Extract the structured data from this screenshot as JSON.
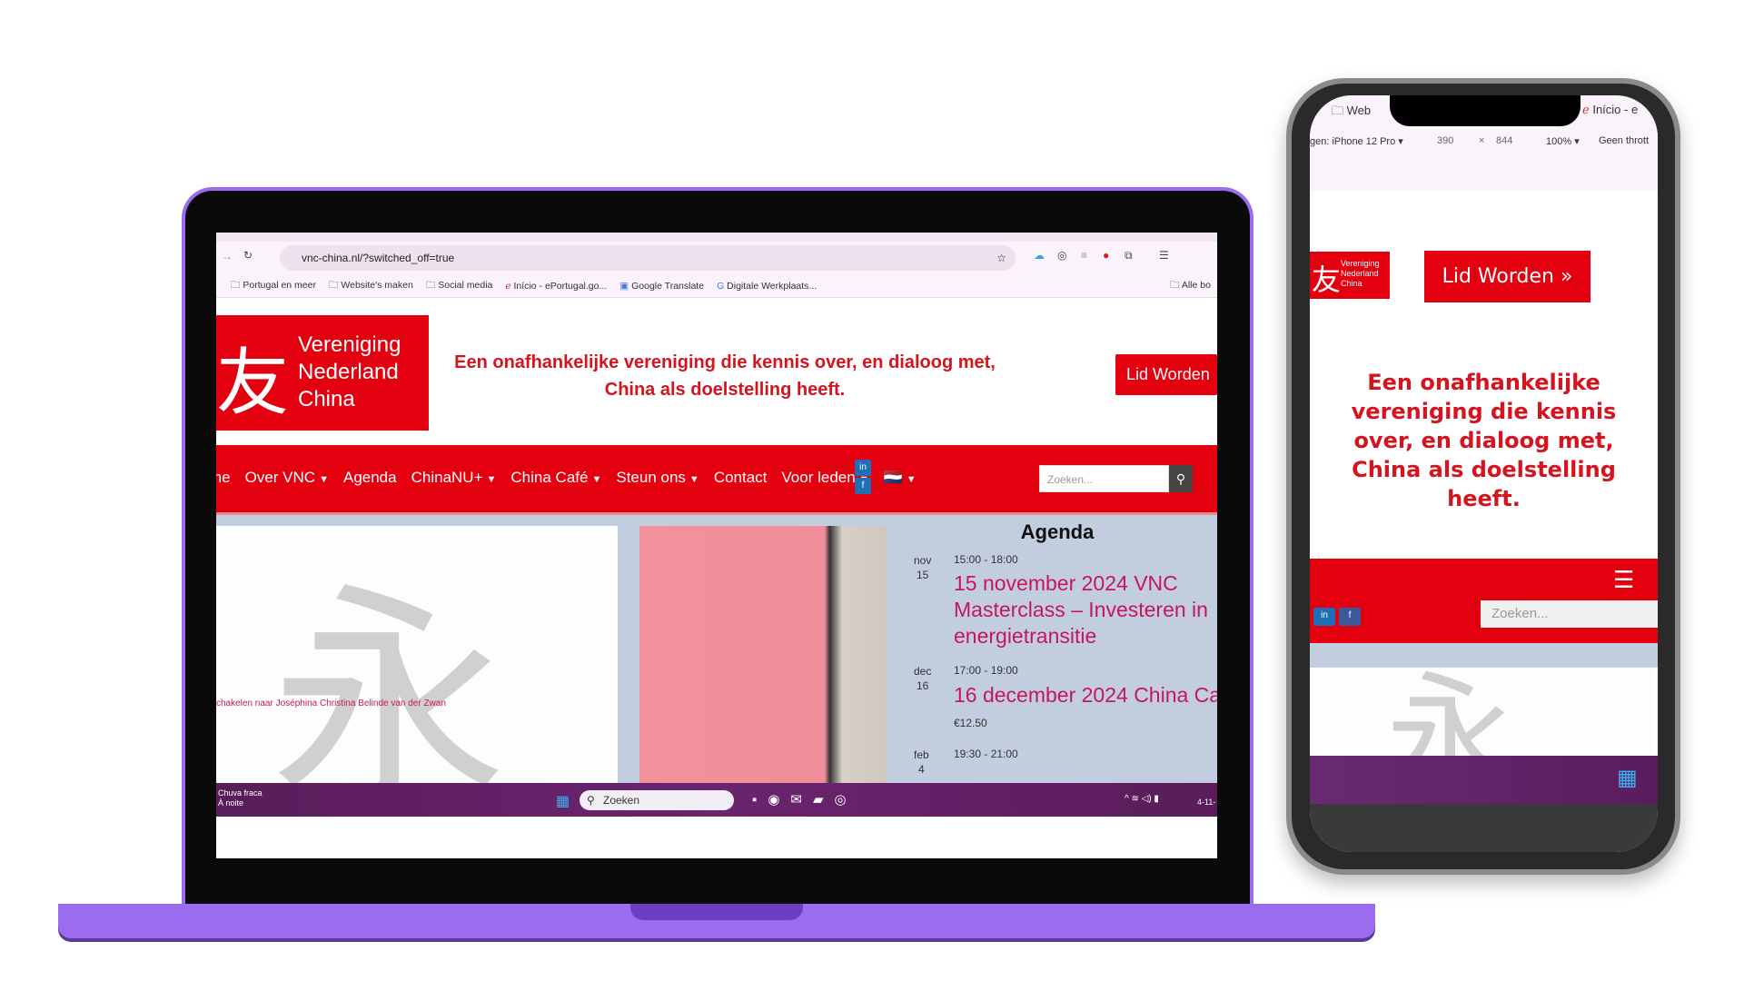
{
  "laptop": {
    "browser": {
      "url": "vnc-china.nl/?switched_off=true",
      "bookmarks": [
        "Portugal en meer",
        "Website's maken",
        "Social media",
        "Início - ePortugal.go...",
        "Google Translate",
        "Digitale Werkplaats..."
      ],
      "all_bookmarks": "Alle bo"
    },
    "site": {
      "logo": {
        "glyph": "友",
        "lines": [
          "Vereniging",
          "Nederland",
          "China"
        ]
      },
      "tagline": "Een onafhankelijke vereniging die kennis over, en dialoog met, China als doelstelling heeft.",
      "cta": "Lid Worden",
      "nav": [
        {
          "label": "me",
          "dropdown": false
        },
        {
          "label": "Over VNC",
          "dropdown": true
        },
        {
          "label": "Agenda",
          "dropdown": false
        },
        {
          "label": "ChinaNU+",
          "dropdown": true
        },
        {
          "label": "China Café",
          "dropdown": true
        },
        {
          "label": "Steun ons",
          "dropdown": true
        },
        {
          "label": "Contact",
          "dropdown": false
        },
        {
          "label": "Voor leden",
          "dropdown": true
        },
        {
          "label": "🇳🇱",
          "dropdown": true
        }
      ],
      "social": [
        "linkedin-icon",
        "facebook-icon"
      ],
      "search_placeholder": "Zoeken...",
      "image_caption": "chakelen naar Joséphina Christina Belinde van der Zwan",
      "agenda": {
        "title": "Agenda",
        "events": [
          {
            "month": "nov",
            "day": "15",
            "time": "15:00 - 18:00",
            "title": "15 november 2024 VNC Masterclass – Investeren in energietransitie"
          },
          {
            "month": "dec",
            "day": "16",
            "time": "17:00 - 19:00",
            "title": "16 december 2024 China Ca",
            "price": "€12.50"
          },
          {
            "month": "feb",
            "day": "4",
            "time": "19:30 - 21:00"
          }
        ]
      }
    },
    "taskbar": {
      "weather1": "Chuva fraca",
      "weather2": "À noite",
      "search": "Zoeken",
      "date": "4-11-"
    }
  },
  "phone": {
    "devtools": {
      "tab1": "Web",
      "tab2": "Início - e",
      "device": "gen: iPhone 12 Pro ▾",
      "width": "390",
      "x": "×",
      "height": "844",
      "zoom": "100% ▾",
      "throttle": "Geen thrott"
    },
    "cta": "Lid Worden »",
    "tagline": "Een onafhankelijke vereniging die kennis over, en dialoog met, China als doelstelling heeft.",
    "search_placeholder": "Zoeken..."
  },
  "colors": {
    "brand_red": "#e3000f",
    "device_purple": "#9b6cf0",
    "taskbar": "#6a2470"
  }
}
